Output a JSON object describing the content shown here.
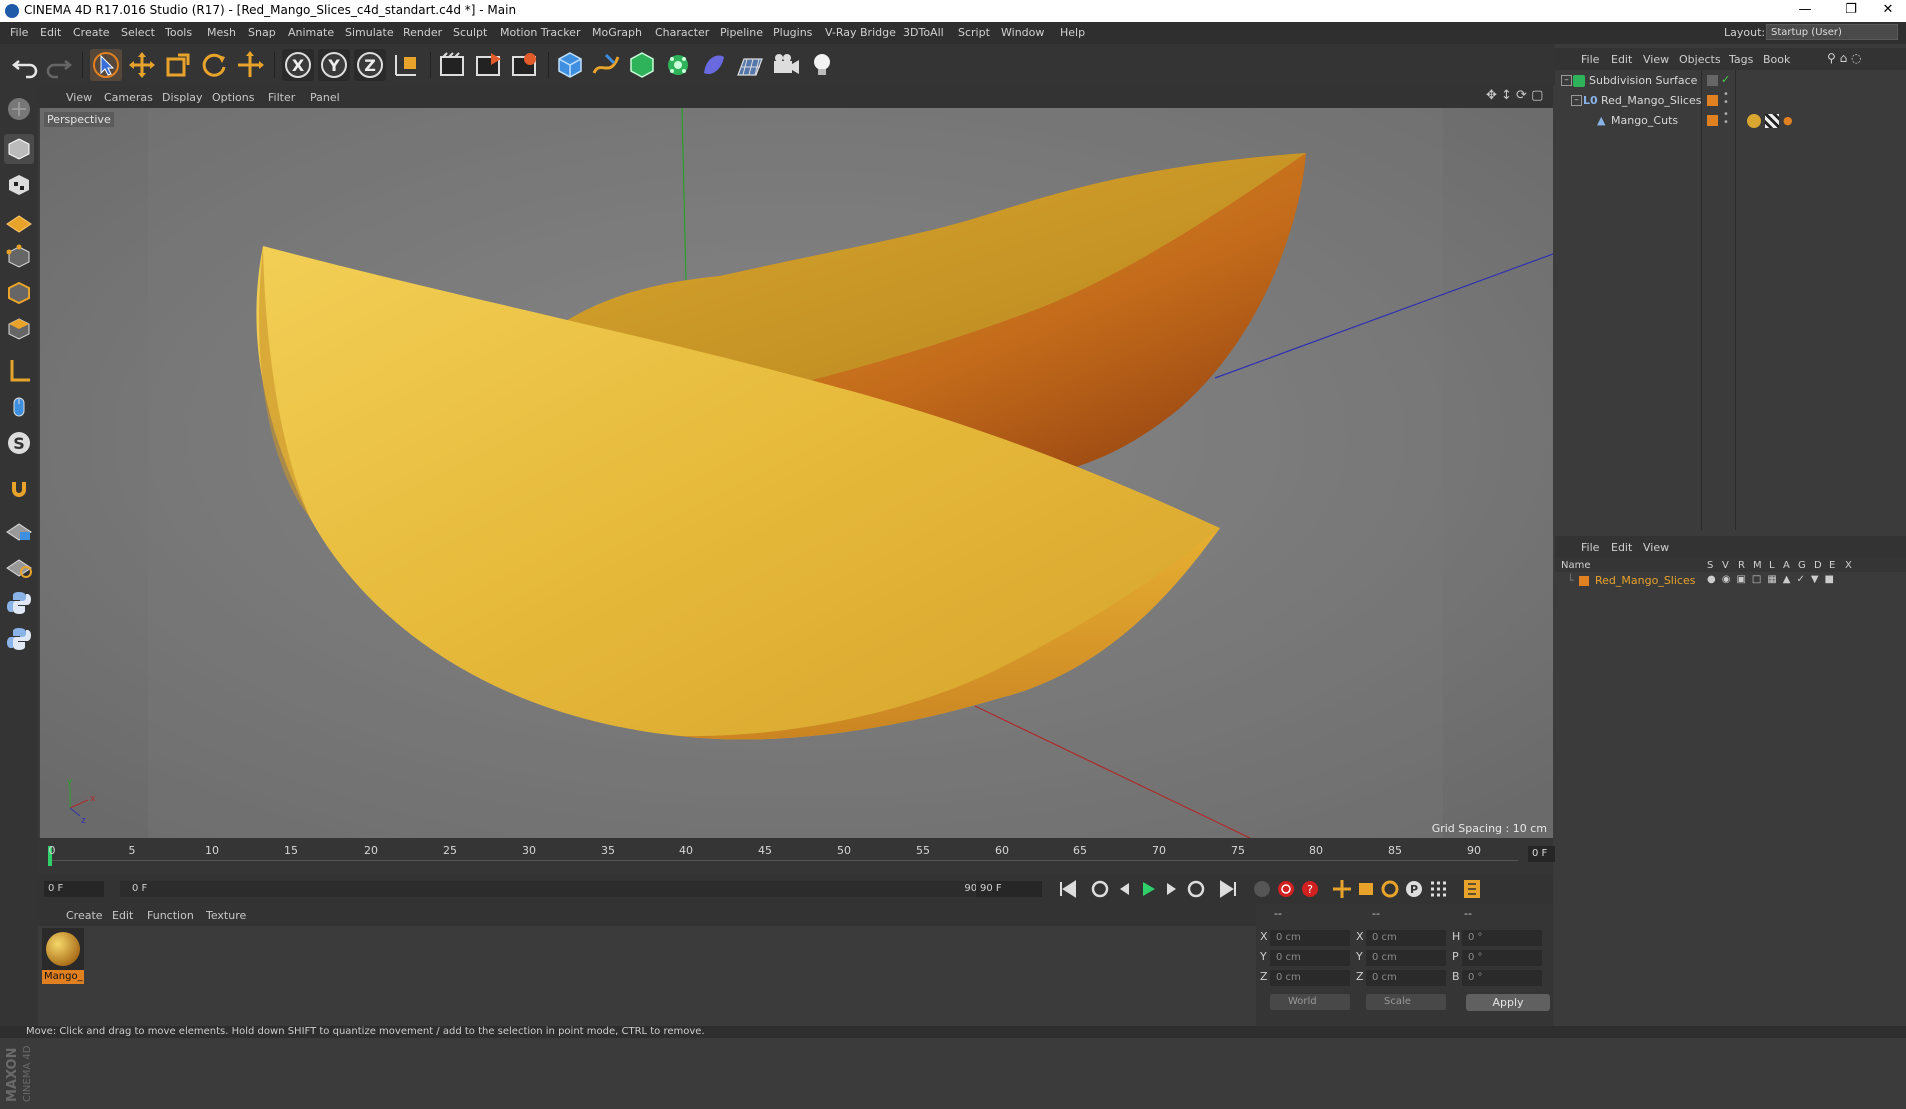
{
  "window": {
    "title": "CINEMA 4D R17.016 Studio (R17) - [Red_Mango_Slices_c4d_standart.c4d *] - Main",
    "controls": [
      "minimize-icon",
      "restore-icon",
      "close-icon"
    ]
  },
  "menubar": {
    "items": [
      "File",
      "Edit",
      "Create",
      "Select",
      "Tools",
      "Mesh",
      "Snap",
      "Animate",
      "Simulate",
      "Render",
      "Sculpt",
      "Motion Tracker",
      "MoGraph",
      "Character",
      "Pipeline",
      "Plugins",
      "V-Ray Bridge",
      "3DToAll",
      "Script",
      "Window",
      "Help"
    ],
    "layout_label": "Layout:",
    "layout_value": "Startup (User)"
  },
  "toolbar": {
    "icons": [
      "undo-icon",
      "redo-icon",
      "select-arrow-icon",
      "move-icon",
      "scale-icon",
      "rotate-icon",
      "transform-icon",
      "x-axis-icon",
      "y-axis-icon",
      "z-axis-icon",
      "coordinate-system-icon",
      "render-view-icon",
      "render-picture-viewer-icon",
      "render-settings-icon",
      "cube-icon",
      "pen-spline-icon",
      "subdivision-nurbs-icon",
      "cloner-icon",
      "deformer-icon",
      "floor-icon",
      "camera-icon",
      "light-icon"
    ]
  },
  "left_tools": {
    "icons": [
      "make-editable-icon",
      "model-mode-icon",
      "texture-mode-icon",
      "workplane-icon",
      "points-mode-icon",
      "edges-mode-icon",
      "polygons-mode-icon",
      "axis-mode-icon",
      "tweak-mode-icon",
      "solo-icon",
      "snap-magnet-icon",
      "workplane-lock-icon",
      "workplane-grid-icon",
      "python-icon",
      "python-script-icon"
    ]
  },
  "viewport": {
    "menu": [
      "View",
      "Cameras",
      "Display",
      "Options",
      "Filter",
      "Panel"
    ],
    "label": "Perspective",
    "grid_spacing": "Grid Spacing : 10 cm",
    "axis_labels": {
      "y": "y",
      "x": "x",
      "z": "z"
    }
  },
  "timeline": {
    "ticks": [
      "0",
      "5",
      "10",
      "15",
      "20",
      "25",
      "30",
      "35",
      "40",
      "45",
      "50",
      "55",
      "60",
      "65",
      "70",
      "75",
      "80",
      "85",
      "90"
    ],
    "current_frame": "0 F"
  },
  "transport": {
    "start_field": "0 F",
    "range_start": "0 F",
    "range_end": "90 F",
    "end_field": "90 F"
  },
  "material_manager": {
    "menu": [
      "Create",
      "Edit",
      "Function",
      "Texture"
    ],
    "materials": [
      {
        "label": "Mango_"
      }
    ]
  },
  "coordinates": {
    "headers": [
      "--",
      "--",
      "--"
    ],
    "rows": [
      {
        "l1": "X",
        "v1": "0 cm",
        "l2": "X",
        "v2": "0 cm",
        "l3": "H",
        "v3": "0 °"
      },
      {
        "l1": "Y",
        "v1": "0 cm",
        "l2": "Y",
        "v2": "0 cm",
        "l3": "P",
        "v3": "0 °"
      },
      {
        "l1": "Z",
        "v1": "0 cm",
        "l2": "Z",
        "v2": "0 cm",
        "l3": "B",
        "v3": "0 °"
      }
    ],
    "mode_select": "World",
    "type_select": "Scale",
    "apply_label": "Apply"
  },
  "object_manager": {
    "menu": [
      "File",
      "Edit",
      "View",
      "Objects",
      "Tags",
      "Book"
    ],
    "objects": [
      {
        "name": "Subdivision Surface",
        "indent": 0
      },
      {
        "name": "Red_Mango_Slices",
        "indent": 1
      },
      {
        "name": "Mango_Cuts",
        "indent": 2
      }
    ]
  },
  "layer_manager": {
    "menu": [
      "File",
      "Edit",
      "View"
    ],
    "columns": [
      "Name",
      "S",
      "V",
      "R",
      "M",
      "L",
      "A",
      "G",
      "D",
      "E",
      "X"
    ],
    "rows": [
      {
        "name": "Red_Mango_Slices"
      }
    ]
  },
  "status": {
    "text": "Move: Click and drag to move elements. Hold down SHIFT to quantize movement / add to the selection in point mode, CTRL to remove."
  },
  "brand": {
    "maxon": "MAXON",
    "c4d": "CINEMA 4D"
  },
  "colors": {
    "accent_orange": "#e08020",
    "viewport_bg": "#6f6f6f",
    "mango_yellow": "#e8b43a"
  }
}
